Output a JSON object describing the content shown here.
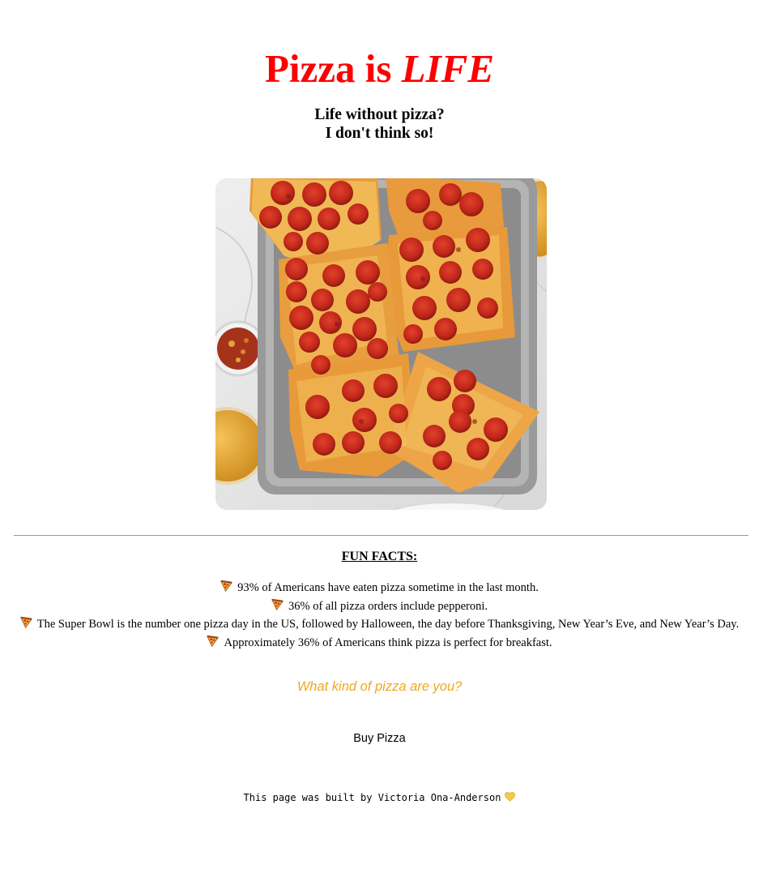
{
  "header": {
    "title_main": "Pizza is ",
    "title_emphasis": "LIFE",
    "subtitle_line1": "Life without pizza?",
    "subtitle_line2": "I don't think so!"
  },
  "photo": {
    "icon": "pepperoni-pizza-photo"
  },
  "fun_facts": {
    "heading": "FUN FACTS:",
    "bullet_icon": "pizza-slice-icon",
    "items": [
      "93% of Americans have eaten pizza sometime in the last month.",
      "36% of all pizza orders include pepperoni.",
      "The Super Bowl is the number one pizza day in the US, followed by Halloween, the day before Thanksgiving, New Year’s Eve, and New Year’s Day.",
      "Approximately 36% of Americans think pizza is perfect for breakfast."
    ]
  },
  "links": {
    "quiz_label": "What kind of pizza are you?",
    "buy_label": "Buy Pizza"
  },
  "footer": {
    "text": "This page was built by Victoria Ona-Anderson",
    "icon": "yellow-heart-icon"
  },
  "colors": {
    "title": "#ff0000",
    "quiz_link": "#f0a81e",
    "heart": "#f7c948"
  }
}
